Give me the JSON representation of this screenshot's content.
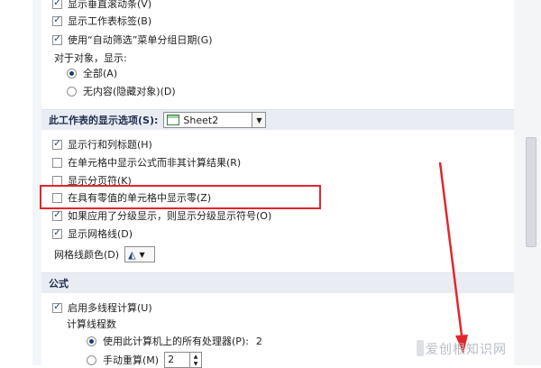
{
  "view_options": {
    "show_vscroll": "显示垂直滚动条(V)",
    "show_tabs": "显示工作表标签(B)",
    "group_dates": "使用“自动筛选”菜单分组日期(G)",
    "objects_label": "对于对象，显示:",
    "radio_all": "全部(A)",
    "radio_none": "无内容(隐藏对象)(D)"
  },
  "sheet_section": {
    "title": "此工作表的显示选项(S):",
    "sheet_value": "Sheet2"
  },
  "sheet_options": {
    "row_col_headers": "显示行和列标题(H)",
    "formulas": "在单元格中显示公式而非其计算结果(R)",
    "page_breaks": "显示分页符(K)",
    "zero_values": "在具有零值的单元格中显示零(Z)",
    "outline_symbols": "如果应用了分级显示，则显示分级显示符号(O)",
    "gridlines": "显示网格线(D)",
    "gridline_color_label": "网格线颜色(D)"
  },
  "formula_section": {
    "title": "公式",
    "multithread": "启用多线程计算(U)",
    "thread_count_label": "计算线程数",
    "use_all_processors": "使用此计算机上的所有处理器(P):",
    "processor_count": "2",
    "manual": "手动重算(M)",
    "manual_value": "2"
  },
  "watermark": "爱创根知识网",
  "colors": {
    "highlight": "#e2262b",
    "section_bg": "#e9edf3"
  }
}
